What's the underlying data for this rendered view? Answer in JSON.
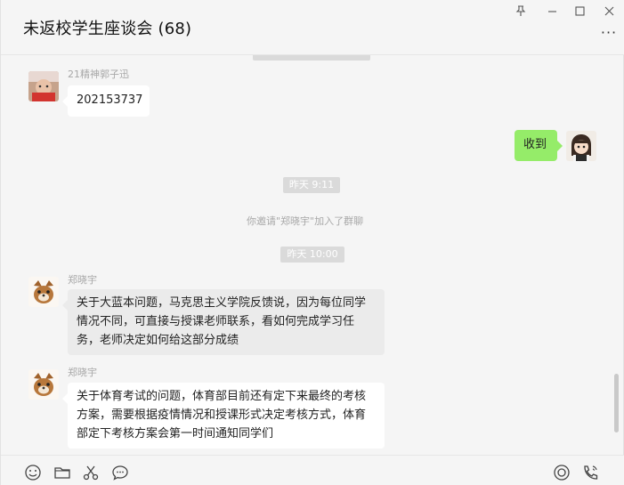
{
  "window": {
    "title": "未返校学生座谈会 (68)",
    "more_label": "···"
  },
  "messages": {
    "m1": {
      "sender": "21精神郭子迅",
      "text": "202153737"
    },
    "m2": {
      "text": "收到"
    },
    "t1": "昨天 9:11",
    "sys1": "你邀请\"郑晓宇\"加入了群聊",
    "t2": "昨天 10:00",
    "m3": {
      "sender": "郑晓宇",
      "text": "关于大蓝本问题，马克思主义学院反馈说，因为每位同学情况不同，可直接与授课老师联系，看如何完成学习任务，老师决定如何给这部分成绩"
    },
    "m4": {
      "sender": "郑晓宇",
      "text": "关于体育考试的问题，体育部目前还有定下来最终的考核方案，需要根据疫情情况和授课形式决定考核方式，体育部定下考核方案会第一时间通知同学们"
    }
  },
  "colors": {
    "self_bubble": "#95ec69",
    "timestamp_bg": "#dadada",
    "window_bg": "#f5f5f5"
  },
  "icons": {
    "toolbar_left": [
      "emoji-icon",
      "folder-icon",
      "scissors-icon",
      "chat-bubble-icon"
    ],
    "toolbar_right": [
      "live-icon",
      "voice-call-icon"
    ],
    "window": [
      "pin-icon",
      "minimize-icon",
      "maximize-icon",
      "close-icon",
      "more-icon"
    ]
  }
}
